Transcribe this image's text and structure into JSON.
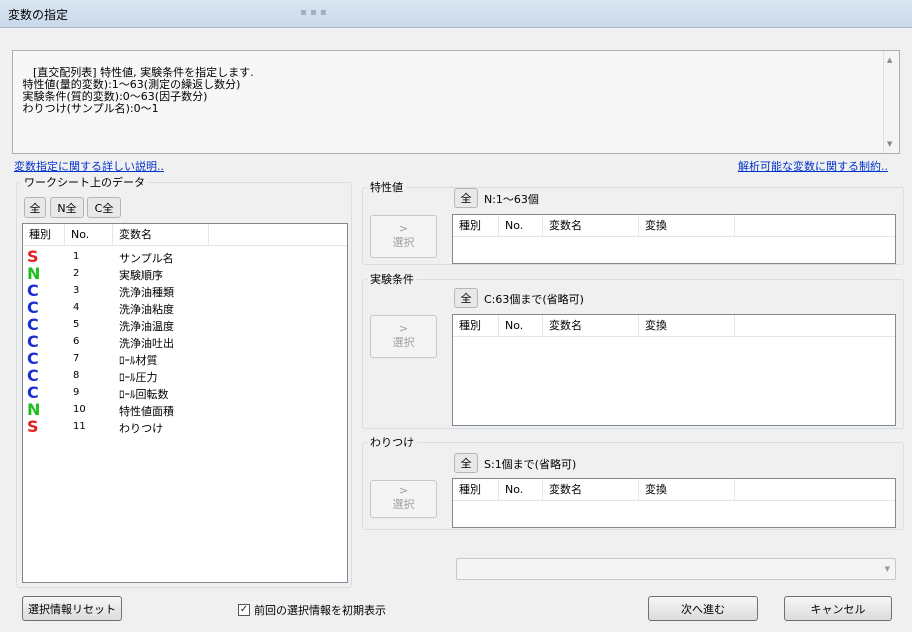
{
  "window": {
    "title": "変数の指定"
  },
  "description": {
    "text": "[直交配列表] 特性値, 実験条件を指定します.\n 特性値(量的変数):1～63(測定の繰返し数分)\n 実験条件(質的変数):0～63(因子数分)\n わりつけ(サンプル名):0～1"
  },
  "links": {
    "detail": "変数指定に関する詳しい説明..",
    "limits": "解析可能な変数に関する制約.."
  },
  "worksheet": {
    "legend": "ワークシート上のデータ",
    "buttons": {
      "all": "全",
      "n_all": "N全",
      "c_all": "C全"
    },
    "columns": {
      "kind": "種別",
      "no": "No.",
      "name": "変数名"
    },
    "rows": [
      {
        "kind": "S",
        "no": "1",
        "name": "サンプル名",
        "color": "#e02020"
      },
      {
        "kind": "N",
        "no": "2",
        "name": "実験順序",
        "color": "#1fbe1f"
      },
      {
        "kind": "C",
        "no": "3",
        "name": "洗浄油種類",
        "color": "#1a2fd0"
      },
      {
        "kind": "C",
        "no": "4",
        "name": "洗浄油粘度",
        "color": "#1a2fd0"
      },
      {
        "kind": "C",
        "no": "5",
        "name": "洗浄油温度",
        "color": "#1a2fd0"
      },
      {
        "kind": "C",
        "no": "6",
        "name": "洗浄油吐出",
        "color": "#1a2fd0"
      },
      {
        "kind": "C",
        "no": "7",
        "name": "ﾛｰﾙ材質",
        "color": "#1a2fd0"
      },
      {
        "kind": "C",
        "no": "8",
        "name": "ﾛｰﾙ圧力",
        "color": "#1a2fd0"
      },
      {
        "kind": "C",
        "no": "9",
        "name": "ﾛｰﾙ回転数",
        "color": "#1a2fd0"
      },
      {
        "kind": "N",
        "no": "10",
        "name": "特性値面積",
        "color": "#1fbe1f"
      },
      {
        "kind": "S",
        "no": "11",
        "name": "わりつけ",
        "color": "#e02020"
      }
    ]
  },
  "groups": {
    "characteristic": {
      "legend": "特性値",
      "all": "全",
      "info": "N:1～63個",
      "select": "選択",
      "arrow": ">"
    },
    "conditions": {
      "legend": "実験条件",
      "all": "全",
      "info": "C:63個まで(省略可)",
      "select": "選択",
      "arrow": ">"
    },
    "assignment": {
      "legend": "わりつけ",
      "all": "全",
      "info": "S:1個まで(省略可)",
      "select": "選択",
      "arrow": ">"
    }
  },
  "target_columns": {
    "kind": "種別",
    "no": "No.",
    "name": "変数名",
    "transform": "変換"
  },
  "footer": {
    "reset": "選択情報リセット",
    "checkbox_label": "前回の選択情報を初期表示",
    "checkbox_checked": true,
    "next": "次へ進む",
    "cancel": "キャンセル"
  }
}
